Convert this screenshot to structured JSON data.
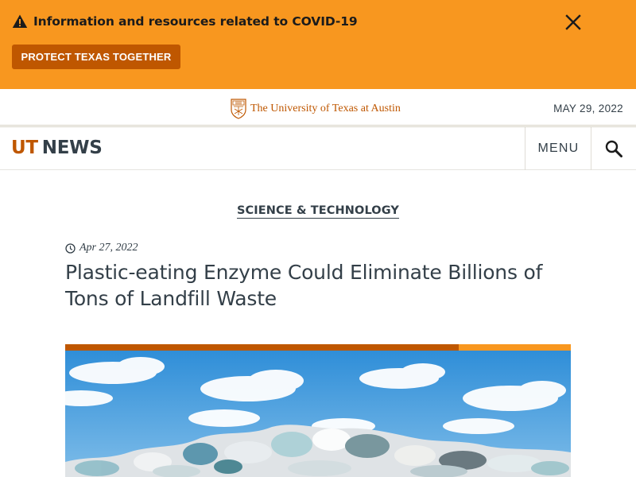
{
  "alert": {
    "icon": "warning-icon",
    "message": "Information and resources related to COVID-19",
    "close_icon": "close-icon",
    "button_label": "PROTECT TEXAS TOGETHER",
    "background_color": "#f8971f",
    "button_color": "#bf5700"
  },
  "university_bar": {
    "seal_icon": "ut-seal-icon",
    "name": "The University of Texas at Austin",
    "date": "MAY 29, 2022"
  },
  "header": {
    "logo_part1": "UT",
    "logo_part2": "NEWS",
    "menu_label": "MENU",
    "search_icon": "search-icon",
    "brand_color": "#bf5700"
  },
  "article": {
    "category": "SCIENCE & TECHNOLOGY",
    "date_icon": "clock-icon",
    "date": "Apr 27, 2022",
    "title": "Plastic-eating Enzyme Could Eliminate Billions of Tons of Landfill Waste",
    "hero_image": "landfill-plastic-waste-photo"
  }
}
